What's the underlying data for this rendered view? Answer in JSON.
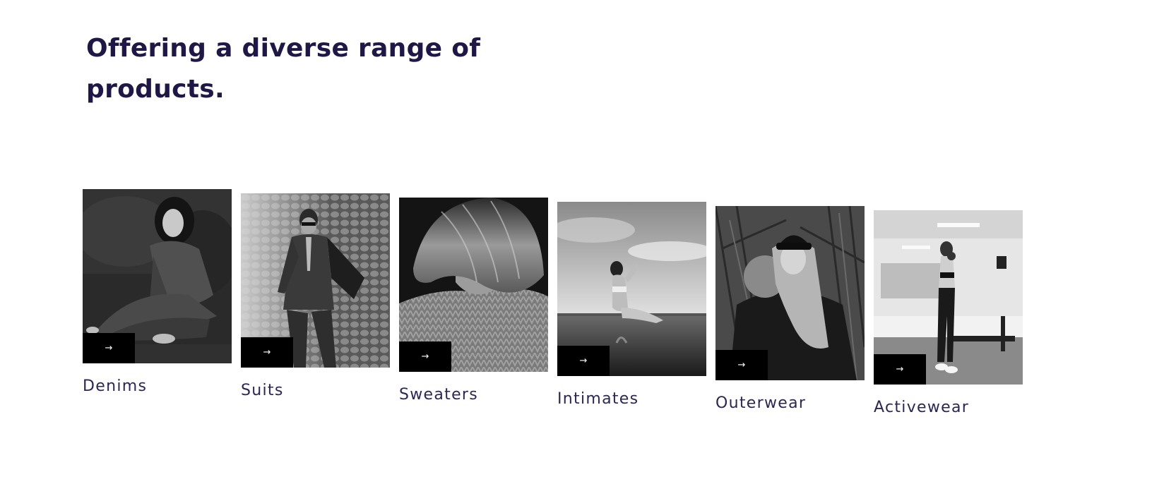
{
  "section": {
    "heading": "Offering a diverse range of products."
  },
  "categories": [
    {
      "label": "Denims",
      "arrow": "→",
      "image": "woman-in-denim-jacket-photo"
    },
    {
      "label": "Suits",
      "arrow": "→",
      "image": "man-in-suit-photo"
    },
    {
      "label": "Sweaters",
      "arrow": "→",
      "image": "knit-sweater-photo"
    },
    {
      "label": "Intimates",
      "arrow": "→",
      "image": "woman-in-infinity-pool-photo"
    },
    {
      "label": "Outerwear",
      "arrow": "→",
      "image": "woman-in-winter-coat-photo"
    },
    {
      "label": "Activewear",
      "arrow": "→",
      "image": "woman-in-gym-photo"
    }
  ],
  "colors": {
    "heading": "#1f1846",
    "label": "#2b2753",
    "button_bg": "#000000",
    "button_fg": "#ffffff"
  }
}
